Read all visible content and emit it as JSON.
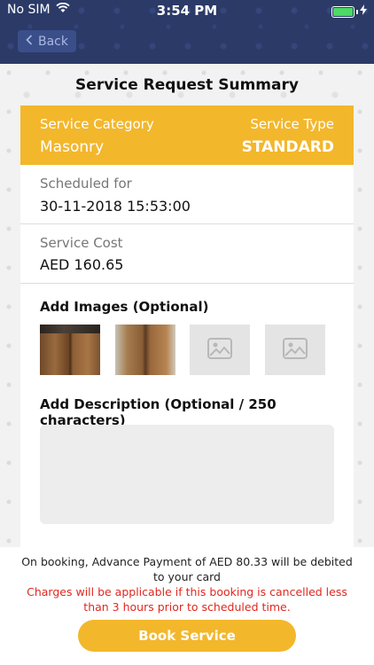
{
  "status_bar": {
    "carrier": "No SIM",
    "time": "3:54 PM"
  },
  "nav": {
    "back_label": "Back"
  },
  "page_title": "Service Request Summary",
  "category": {
    "category_label": "Service Category",
    "category_value": "Masonry",
    "type_label": "Service Type",
    "type_value": "STANDARD"
  },
  "schedule": {
    "label": "Scheduled for",
    "value": "30-11-2018 15:53:00"
  },
  "cost": {
    "label": "Service Cost",
    "value": "AED 160.65"
  },
  "images": {
    "title": "Add Images (Optional)",
    "items": [
      "door-photo",
      "door-photo",
      "image-placeholder",
      "image-placeholder"
    ]
  },
  "description": {
    "title": "Add Description (Optional / 250 characters)",
    "value": ""
  },
  "footer": {
    "payment_note": "On booking, Advance Payment of AED 80.33 will be debited to your card",
    "cancel_warning": "Charges will be applicable if this booking is cancelled less than 3 hours prior to scheduled time.",
    "book_label": "Book Service"
  },
  "colors": {
    "header_bg": "#2b3a67",
    "accent": "#f3b72c",
    "warning": "#e0281f"
  }
}
